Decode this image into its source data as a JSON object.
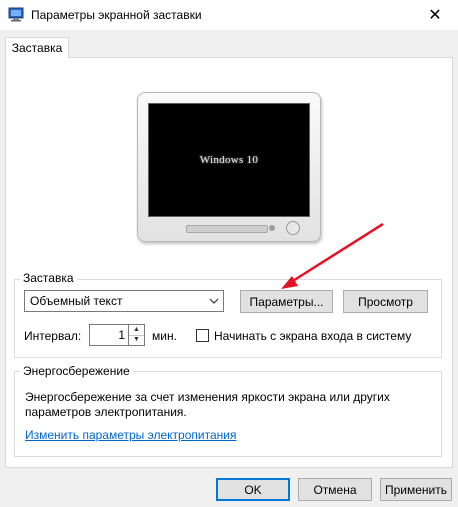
{
  "window": {
    "title": "Параметры экранной заставки",
    "close_symbol": "✕"
  },
  "tabs": [
    {
      "label": "Заставка"
    }
  ],
  "preview": {
    "screen_text": "Windows 10"
  },
  "screensaver_group": {
    "label": "Заставка",
    "selected": "Объемный текст",
    "parameters_button": "Параметры...",
    "preview_button": "Просмотр",
    "interval_label": "Интервал:",
    "interval_value": "1",
    "interval_unit": "мин.",
    "logon_checkbox_label": "Начинать с экрана входа в систему",
    "logon_checked": false
  },
  "power_group": {
    "label": "Энергосбережение",
    "description_line1": "Энергосбережение за счет изменения яркости экрана или других",
    "description_line2": "параметров электропитания.",
    "link": "Изменить параметры электропитания"
  },
  "buttons": {
    "ok": "OK",
    "cancel": "Отмена",
    "apply": "Применить"
  },
  "colors": {
    "accent": "#0078d7",
    "link": "#0066cc",
    "annotation_arrow": "#e81123"
  },
  "icons": [
    "display-settings-icon",
    "close-icon",
    "chevron-down-icon",
    "spin-up-icon",
    "spin-down-icon"
  ]
}
